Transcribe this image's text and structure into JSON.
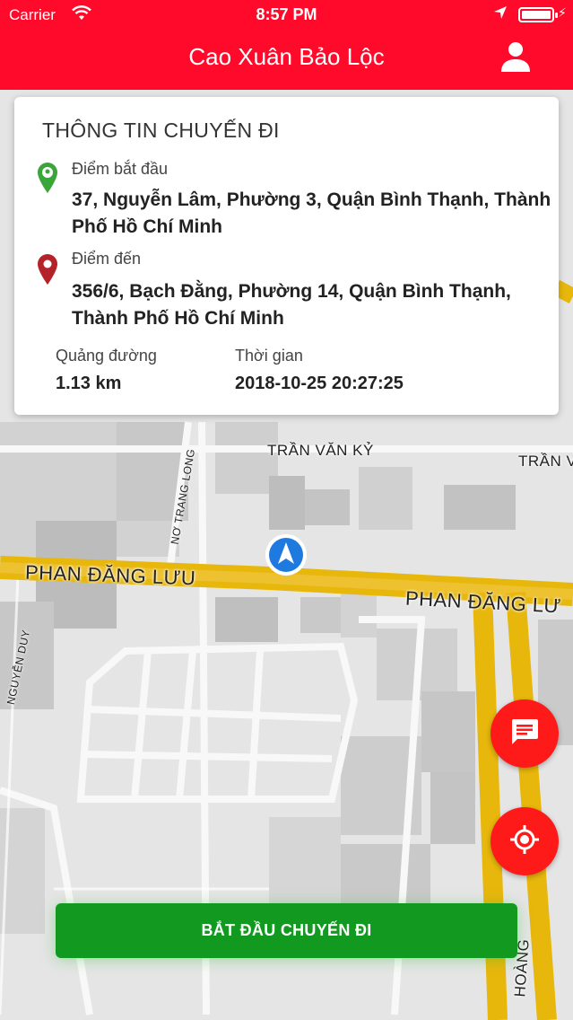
{
  "status_bar": {
    "carrier": "Carrier",
    "time": "8:57 PM"
  },
  "header": {
    "title": "Cao Xuân Bảo Lộc",
    "profile_icon": "person-icon"
  },
  "trip_card": {
    "title": "THÔNG TIN CHUYẾN ĐI",
    "start": {
      "label": "Điểm bắt đầu",
      "address": "37, Nguyễn Lâm, Phường 3, Quận Bình Thạnh, Thành Phố Hồ Chí Minh",
      "pin_color": "#3aa63a"
    },
    "destination": {
      "label": "Điểm đến",
      "address": "356/6, Bạch Đằng, Phường 14, Quận Bình Thạnh, Thành Phố Hồ Chí Minh",
      "pin_color": "#b5232a"
    },
    "distance": {
      "label": "Quảng đường",
      "value": "1.13 km"
    },
    "time": {
      "label": "Thời gian",
      "value": "2018-10-25 20:27:25"
    }
  },
  "map": {
    "street_labels": {
      "phan_dang_luu_left": "PHAN ĐĂNG LƯU",
      "phan_dang_luu_right": "PHAN ĐĂNG LƯ",
      "tran_van_ky": "TRẦN VĂN KỶ",
      "tran_van_right": "TRẦN VĂ",
      "no_trang_long": "NƠ TRANG LONG",
      "nguyen_duy": "NGUYỄN DUY",
      "hoang": "HOÀNG"
    },
    "road_color": "#e8b70c",
    "location_marker_color": "#1f7ae0"
  },
  "buttons": {
    "chat_icon": "chat-icon",
    "locate_icon": "crosshair-icon",
    "start_trip": "BẮT ĐẦU CHUYẾN ĐI",
    "accent_color": "#ff1a1a",
    "start_color": "#119a1f"
  }
}
